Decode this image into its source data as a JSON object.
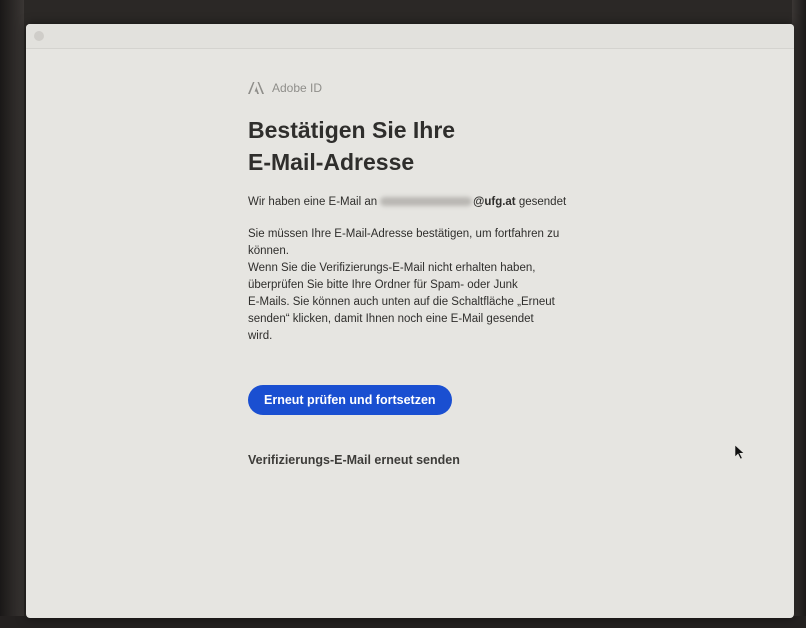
{
  "brand": {
    "logo_icon": "adobe-logo-icon",
    "name": "Adobe ID"
  },
  "main": {
    "heading_line1": "Bestätigen Sie Ihre",
    "heading_line2": "E-Mail-Adresse",
    "sent_prefix": "Wir haben eine E-Mail an",
    "email_domain": "@ufg.at",
    "sent_suffix": "gesendet",
    "body_line1": "Sie müssen Ihre E-Mail-Adresse bestätigen, um fortfahren zu",
    "body_line2": "können.",
    "body_line3": "Wenn Sie die Verifizierungs-E-Mail nicht erhalten haben,",
    "body_line4": "überprüfen Sie bitte Ihre Ordner für Spam- oder Junk",
    "body_line5": "E-Mails. Sie können auch unten auf die Schaltfläche „Erneut",
    "body_line6": "senden“ klicken, damit Ihnen noch eine E-Mail gesendet",
    "body_line7": "wird.",
    "primary_button": "Erneut prüfen und fortsetzen",
    "resend_link": "Verifizierungs-E-Mail erneut senden"
  },
  "colors": {
    "primary_button": "#1a4fd1",
    "page_background": "#e6e5e1",
    "text": "#2f2e2c"
  }
}
